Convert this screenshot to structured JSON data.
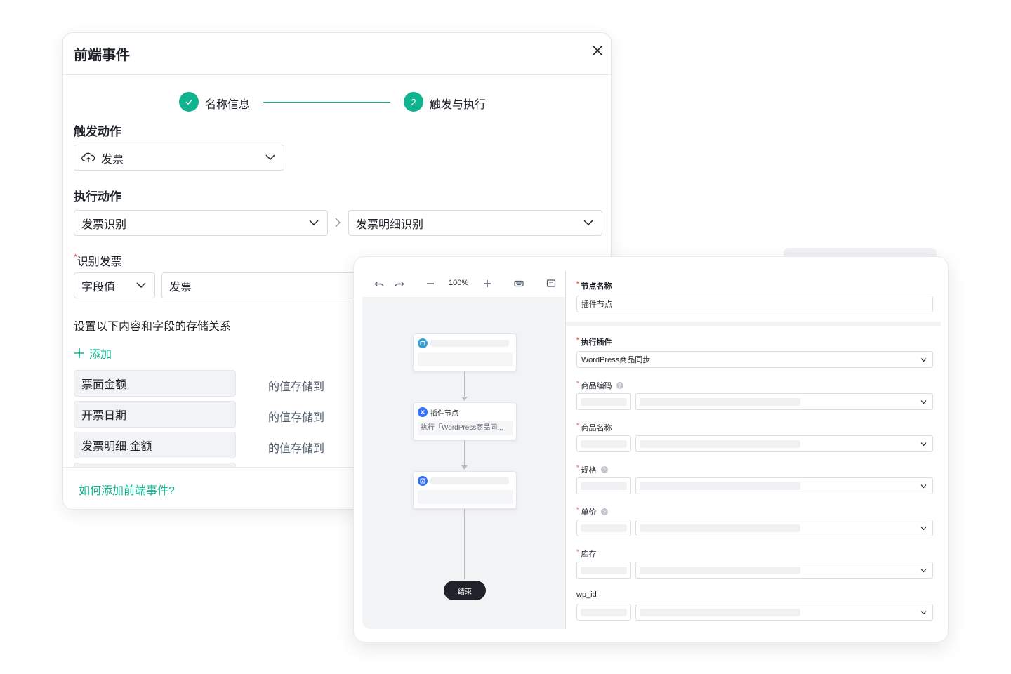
{
  "dialog": {
    "title": "前端事件",
    "steps": [
      {
        "label": "名称信息",
        "state": "done",
        "icon": "check-icon"
      },
      {
        "number": "2",
        "label": "触发与执行",
        "state": "active"
      }
    ],
    "trigger": {
      "title": "触发动作",
      "select_icon": "cloud-upload-icon",
      "select_value": "发票"
    },
    "execute": {
      "title": "执行动作",
      "select1_value": "发票识别",
      "select2_value": "发票明细识别"
    },
    "recognize": {
      "label": "识别发票",
      "required_mark": "*",
      "type_value": "字段值",
      "field_value": "发票"
    },
    "storage": {
      "description": "设置以下内容和字段的存储关系",
      "add_label": "添加",
      "rows": [
        {
          "field": "票面金额",
          "suffix": "的值存储到"
        },
        {
          "field": "开票日期",
          "suffix": "的值存储到"
        },
        {
          "field": "发票明细.金额",
          "suffix": "的值存储到"
        }
      ]
    },
    "footer": {
      "help_link": "如何添加前端事件?"
    },
    "accent_color": "#0fb48f"
  },
  "workflow": {
    "toolbar": {
      "zoom": "100%"
    },
    "nodes": [
      {
        "type": "skeleton",
        "icon": "message-icon",
        "color": "#3aa0d8"
      },
      {
        "type": "plugin",
        "icon": "plugin-icon",
        "color": "#3370ff",
        "title": "插件节点",
        "description": "执行「WordPress商品同..."
      },
      {
        "type": "skeleton",
        "icon": "edit-icon",
        "color": "#3370ff"
      }
    ],
    "end_label": "结束",
    "properties": {
      "node_name_label": "节点名称",
      "node_name_value": "插件节点",
      "plugin_label": "执行插件",
      "plugin_value": "WordPress商品同步",
      "fields": [
        {
          "label": "商品编码",
          "required": true,
          "help": true
        },
        {
          "label": "商品名称",
          "required": true,
          "help": false
        },
        {
          "label": "规格",
          "required": true,
          "help": true
        },
        {
          "label": "单价",
          "required": true,
          "help": true
        },
        {
          "label": "库存",
          "required": true,
          "help": false
        },
        {
          "label": "wp_id",
          "required": false,
          "help": false
        }
      ]
    }
  }
}
